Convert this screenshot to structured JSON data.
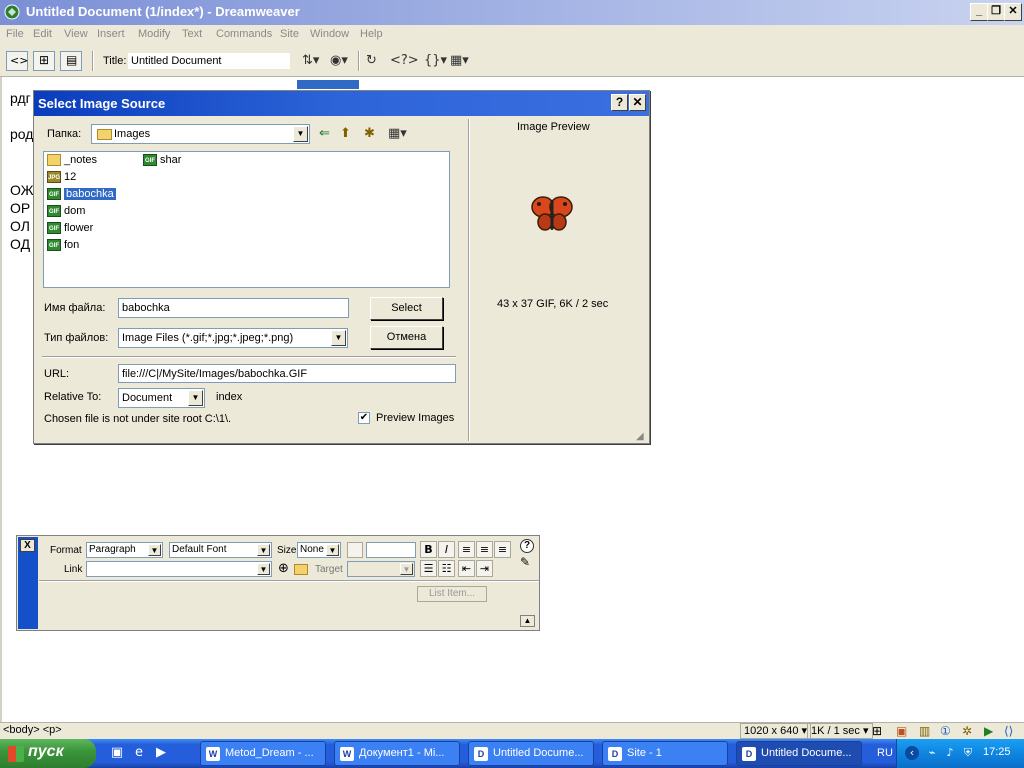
{
  "window": {
    "title": "Untitled Document (1/index*) - Dreamweaver",
    "controls": {
      "minimize": "_",
      "restore": "❐",
      "close": "✕"
    }
  },
  "menu": [
    "File",
    "Edit",
    "View",
    "Insert",
    "Modify",
    "Text",
    "Commands",
    "Site",
    "Window",
    "Help"
  ],
  "toolbar": {
    "title_label": "Title:",
    "title_value": "Untitled Document",
    "icons": [
      "code-view-icon",
      "split-view-icon",
      "design-view-icon",
      "file-management-icon",
      "preview-browser-icon",
      "refresh-icon",
      "reference-icon",
      "code-navigation-icon",
      "view-options-icon"
    ]
  },
  "document": {
    "lines": [
      "рдг",
      "род",
      "ОЖ",
      "ОР",
      "ОЛ",
      "ОД"
    ]
  },
  "dialog": {
    "title": "Select Image Source",
    "help_btn": "?",
    "close_btn": "✕",
    "look_in_label": "Папка:",
    "look_in_value": "Images",
    "files": [
      {
        "name": "_notes",
        "type": "folder"
      },
      {
        "name": "12",
        "type": "jpg"
      },
      {
        "name": "babochka",
        "type": "gif",
        "selected": true
      },
      {
        "name": "dom",
        "type": "gif"
      },
      {
        "name": "flower",
        "type": "gif"
      },
      {
        "name": "fon",
        "type": "gif"
      },
      {
        "name": "shar",
        "type": "gif"
      }
    ],
    "filename_label": "Имя файла:",
    "filename_value": "babochka",
    "filetype_label": "Тип файлов:",
    "filetype_value": "Image Files (*.gif;*.jpg;*.jpeg;*.png)",
    "select_btn": "Select",
    "cancel_btn": "Отмена",
    "url_label": "URL:",
    "url_value": "file:///C|/MySite/Images/babochka.GIF",
    "relative_label": "Relative To:",
    "relative_value": "Document",
    "relative_doc": "index",
    "note": "Chosen file is not under site root C:\\1\\.",
    "preview_check_label": "Preview Images",
    "preview_checked": true,
    "preview_title": "Image Preview",
    "preview_info": "43 x 37 GIF, 6K / 2 sec"
  },
  "properties": {
    "close_btn": "X",
    "format_label": "Format",
    "format_value": "Paragraph",
    "font_value": "Default Font",
    "size_label": "Size",
    "size_value": "None",
    "link_label": "Link",
    "link_value": "",
    "target_label": "Target",
    "target_value": "",
    "list_item_btn": "List Item...",
    "bold": "B",
    "italic": "I"
  },
  "status": {
    "tag": "<body> <p>",
    "dimensions": "1020 x 640",
    "size_time": "1K / 1 sec"
  },
  "taskbar": {
    "start_label": "пуск",
    "tasks": [
      {
        "label": "Metod_Dream - ...",
        "icon": "W",
        "active": false
      },
      {
        "label": "Документ1 - Mi...",
        "icon": "W",
        "active": false
      },
      {
        "label": "Untitled Docume...",
        "icon": "D",
        "active": false
      },
      {
        "label": "Site - 1",
        "icon": "D",
        "active": false
      },
      {
        "label": "Untitled Docume...",
        "icon": "D",
        "active": true
      }
    ],
    "lang": "RU",
    "clock": "17:25"
  },
  "colors": {
    "dialog_title": "#0a3dbd",
    "selection": "#316ac5",
    "taskbar": "#245edb",
    "start": "#3c963c"
  }
}
